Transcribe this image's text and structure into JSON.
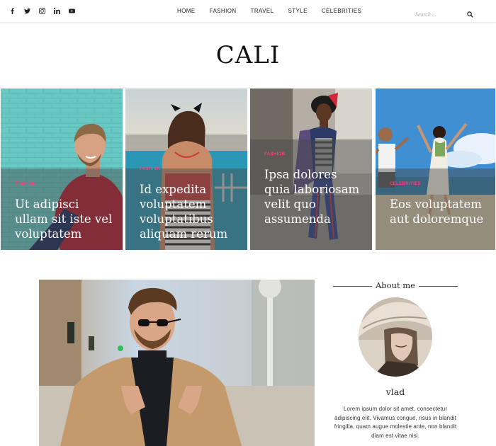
{
  "social": [
    "facebook-icon",
    "twitter-icon",
    "instagram-icon",
    "linkedin-icon",
    "youtube-icon"
  ],
  "nav": {
    "items": [
      "HOME",
      "FASHION",
      "TRAVEL",
      "STYLE",
      "CELEBRITIES"
    ]
  },
  "search": {
    "placeholder": "Search ..."
  },
  "logo": "CALI",
  "featured": [
    {
      "category": "FASHION",
      "title": "Ut adipisci ullam sit iste vel voluptatem"
    },
    {
      "category": "FASHION",
      "title": "Id expedita voluptatem voluptatibus aliquam rerum"
    },
    {
      "category": "FASHION",
      "title": "Ipsa dolores quia laboriosam velit quo assumenda"
    },
    {
      "category": "CELEBRITIES",
      "title": "Eos voluptatem aut doloremque"
    }
  ],
  "about": {
    "heading": "About me",
    "name": "vlad",
    "bio": "Lorem ipsum dolor sit amet, consectetur adipiscing elit. Vivamus congue, risus in blandit fringilla, quam augue molestie ante, non blandit diam est vitae nisi."
  },
  "colors": {
    "category": "#ff3e7a",
    "overlay": "rgba(70,70,70,0.45)"
  }
}
